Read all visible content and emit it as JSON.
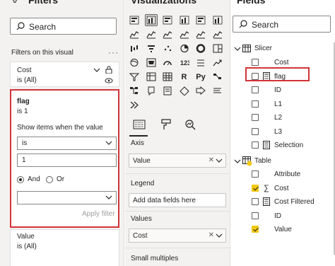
{
  "filters": {
    "title": "Filters",
    "search_placeholder": "Search",
    "section_label": "Filters on this visual",
    "more": "···",
    "cost_card": {
      "name": "Cost",
      "summary": "is (All)"
    },
    "flag_card": {
      "name": "flag",
      "summary": "is 1",
      "show_items_label": "Show items when the value",
      "operator": "is",
      "value": "1",
      "and_label": "And",
      "or_label": "Or",
      "logic_selected": "And",
      "second_operator": "",
      "apply_label": "Apply filter"
    },
    "value_card": {
      "name": "Value",
      "summary": "is (All)"
    }
  },
  "visualizations": {
    "title": "Visualizations",
    "icons": [
      "stacked-bar-chart-icon",
      "stacked-column-chart-icon",
      "clustered-bar-chart-icon",
      "clustered-column-chart-icon",
      "100-bar-chart-icon",
      "100-column-chart-icon",
      "line-chart-icon",
      "area-chart-icon",
      "stacked-area-chart-icon",
      "line-column-chart-icon",
      "line-clustered-column-icon",
      "ribbon-chart-icon",
      "waterfall-chart-icon",
      "funnel-chart-icon",
      "scatter-chart-icon",
      "pie-chart-icon",
      "donut-chart-icon",
      "treemap-icon",
      "map-icon",
      "filled-map-icon",
      "gauge-icon",
      "card-icon",
      "multi-row-card-icon",
      "kpi-icon",
      "slicer-icon",
      "table-icon",
      "matrix-icon",
      "r-visual-icon",
      "python-visual-icon",
      "key-influencers-icon",
      "decomposition-tree-icon",
      "qa-icon",
      "paginated-report-icon",
      "power-apps-icon",
      "power-automate-icon",
      "smart-narrative-icon",
      "more-visuals-icon"
    ],
    "text_glyphs": {
      "r-visual-icon": "R",
      "python-visual-icon": "Py"
    },
    "wells": {
      "axis_label": "Axis",
      "axis_value": "Value",
      "legend_label": "Legend",
      "legend_placeholder": "Add data fields here",
      "values_label": "Values",
      "values_value": "Cost",
      "small_multiples_label": "Small multiples"
    },
    "remove_glyph": "✕"
  },
  "fields": {
    "title": "Fields",
    "search_placeholder": "Search",
    "tables": [
      {
        "name": "Slicer",
        "fields": [
          {
            "label": "Cost",
            "checked": false,
            "icon": "none"
          },
          {
            "label": "flag",
            "checked": false,
            "icon": "calculated-column-icon"
          },
          {
            "label": "ID",
            "checked": false,
            "icon": "none"
          },
          {
            "label": "L1",
            "checked": false,
            "icon": "none"
          },
          {
            "label": "L2",
            "checked": false,
            "icon": "none"
          },
          {
            "label": "L3",
            "checked": false,
            "icon": "none"
          },
          {
            "label": "Selection",
            "checked": false,
            "icon": "calculated-column-icon"
          }
        ]
      },
      {
        "name": "Table",
        "fields": [
          {
            "label": "Attribute",
            "checked": false,
            "icon": "none"
          },
          {
            "label": "Cost",
            "checked": true,
            "icon": "sigma-icon",
            "glyph": "∑"
          },
          {
            "label": "Cost Filtered",
            "checked": false,
            "icon": "calculated-column-icon"
          },
          {
            "label": "ID",
            "checked": false,
            "icon": "none"
          },
          {
            "label": "Value",
            "checked": true,
            "icon": "none"
          }
        ]
      }
    ]
  },
  "colors": {
    "highlight_red": "#d13438",
    "checkbox_yellow": "#f2c811",
    "pane_gray": "#f3f2f1"
  }
}
